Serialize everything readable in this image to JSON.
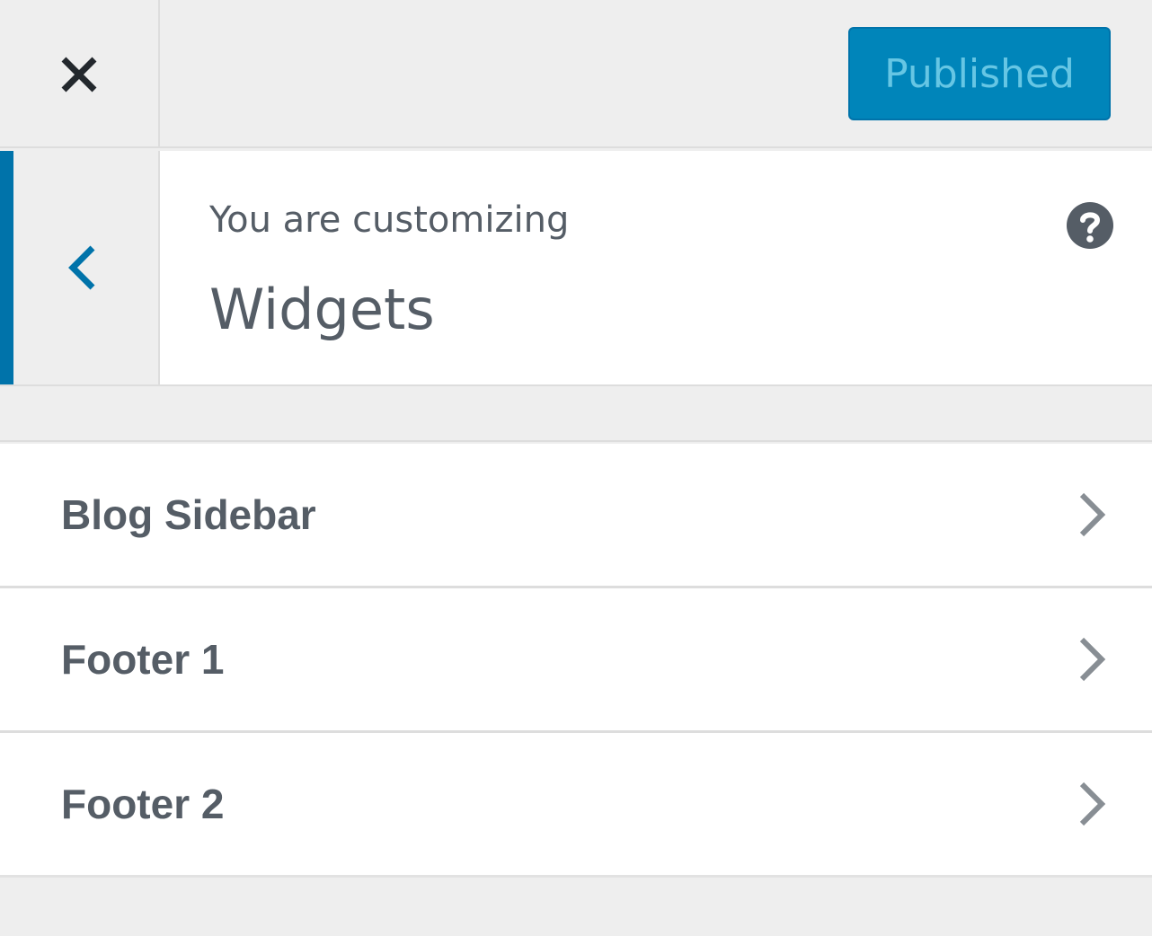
{
  "header": {
    "close_icon": "close-icon",
    "publish_button_label": "Published"
  },
  "section": {
    "back_icon": "chevron-left-icon",
    "customizing_label": "You are customizing",
    "title": "Widgets",
    "help_icon": "help-icon"
  },
  "widget_areas": [
    {
      "label": "Blog Sidebar",
      "icon": "chevron-right-icon"
    },
    {
      "label": "Footer 1",
      "icon": "chevron-right-icon"
    },
    {
      "label": "Footer 2",
      "icon": "chevron-right-icon"
    }
  ],
  "colors": {
    "accent": "#0073aa",
    "publish_bg": "#0085ba",
    "publish_text": "#66c6e4",
    "text": "#555d66",
    "panel_bg": "#eeeeee"
  }
}
